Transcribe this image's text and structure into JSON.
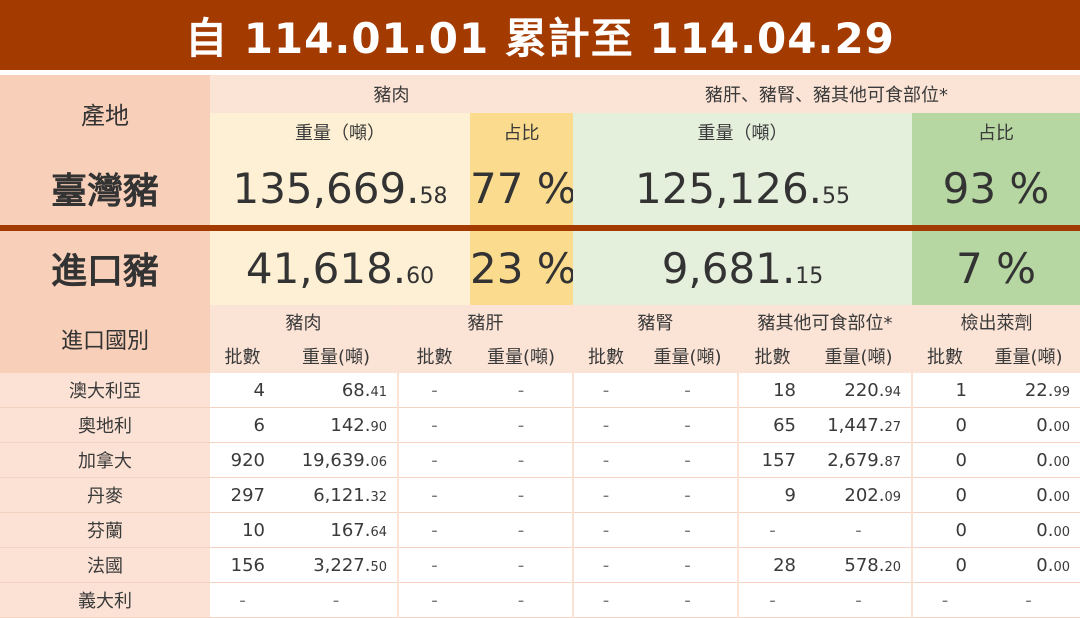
{
  "title": "自 114.01.01 累計至 114.04.29",
  "header": {
    "origin": "產地",
    "pork": "豬肉",
    "organs": "豬肝、豬腎、豬其他可食部位*",
    "weight": "重量（噸）",
    "ratio": "占比"
  },
  "rows": {
    "taiwan": {
      "label": "臺灣豬",
      "pork_w_int": "135,669.",
      "pork_w_dec": "58",
      "pork_p": "77 %",
      "org_w_int": "125,126.",
      "org_w_dec": "55",
      "org_p": "93 %"
    },
    "import": {
      "label": "進口豬",
      "pork_w_int": "41,618.",
      "pork_w_dec": "60",
      "pork_p": "23 %",
      "org_w_int": "9,681.",
      "org_w_dec": "15",
      "org_p": "7 %"
    }
  },
  "breakdown": {
    "country_col": "進口國別",
    "groups": [
      "豬肉",
      "豬肝",
      "豬腎",
      "豬其他可食部位*",
      "檢出萊劑"
    ],
    "batch": "批數",
    "weight": "重量(噸)"
  },
  "countries": [
    {
      "name": "澳大利亞",
      "cells": [
        [
          "4",
          "68.",
          "41"
        ],
        [
          "-",
          "-",
          ""
        ],
        [
          "-",
          "-",
          ""
        ],
        [
          "18",
          "220.",
          "94"
        ],
        [
          "1",
          "22.",
          "99"
        ]
      ]
    },
    {
      "name": "奧地利",
      "cells": [
        [
          "6",
          "142.",
          "90"
        ],
        [
          "-",
          "-",
          ""
        ],
        [
          "-",
          "-",
          ""
        ],
        [
          "65",
          "1,447.",
          "27"
        ],
        [
          "0",
          "0.",
          "00"
        ]
      ]
    },
    {
      "name": "加拿大",
      "cells": [
        [
          "920",
          "19,639.",
          "06"
        ],
        [
          "-",
          "-",
          ""
        ],
        [
          "-",
          "-",
          ""
        ],
        [
          "157",
          "2,679.",
          "87"
        ],
        [
          "0",
          "0.",
          "00"
        ]
      ]
    },
    {
      "name": "丹麥",
      "cells": [
        [
          "297",
          "6,121.",
          "32"
        ],
        [
          "-",
          "-",
          ""
        ],
        [
          "-",
          "-",
          ""
        ],
        [
          "9",
          "202.",
          "09"
        ],
        [
          "0",
          "0.",
          "00"
        ]
      ]
    },
    {
      "name": "芬蘭",
      "cells": [
        [
          "10",
          "167.",
          "64"
        ],
        [
          "-",
          "-",
          ""
        ],
        [
          "-",
          "-",
          ""
        ],
        [
          "-",
          "-",
          ""
        ],
        [
          "0",
          "0.",
          "00"
        ]
      ]
    },
    {
      "name": "法國",
      "cells": [
        [
          "156",
          "3,227.",
          "50"
        ],
        [
          "-",
          "-",
          ""
        ],
        [
          "-",
          "-",
          ""
        ],
        [
          "28",
          "578.",
          "20"
        ],
        [
          "0",
          "0.",
          "00"
        ]
      ]
    },
    {
      "name": "義大利",
      "cells": [
        [
          "-",
          "-",
          ""
        ],
        [
          "-",
          "-",
          ""
        ],
        [
          "-",
          "-",
          ""
        ],
        [
          "-",
          "-",
          ""
        ],
        [
          "-",
          "-",
          ""
        ]
      ]
    }
  ]
}
